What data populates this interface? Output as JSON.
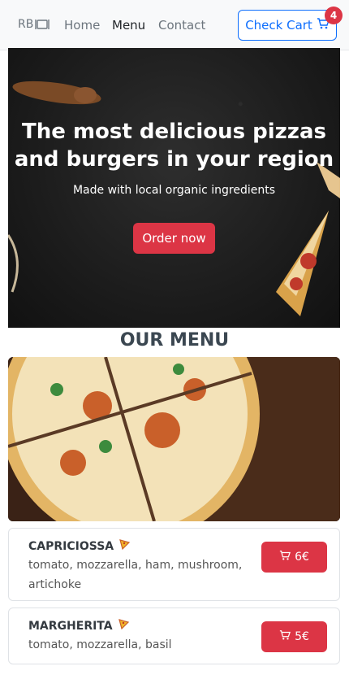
{
  "navbar": {
    "brand": "RB",
    "links": [
      "Home",
      "Menu",
      "Contact"
    ],
    "cart_label": "Check Cart",
    "cart_count": "4"
  },
  "hero": {
    "title": "The most delicious pizzas and burgers in your region",
    "subtitle": "Made with local organic ingredients",
    "cta": "Order now"
  },
  "menu": {
    "heading": "OUR MENU",
    "items": [
      {
        "name": "CAPRICIOSSA",
        "desc": "tomato, mozzarella, ham, mushroom, artichoke",
        "price": "6€"
      },
      {
        "name": "MARGHERITA",
        "desc": "tomato, mozzarella, basil",
        "price": "5€"
      }
    ]
  },
  "icons": {
    "brand_icon": "dining-table-icon",
    "cart_icon": "shopping-cart-icon",
    "pizza_icon": "pizza-slice-icon"
  },
  "colors": {
    "primary": "#0d6efd",
    "danger": "#dc3545",
    "navbar_bg": "#f8f9fa"
  }
}
